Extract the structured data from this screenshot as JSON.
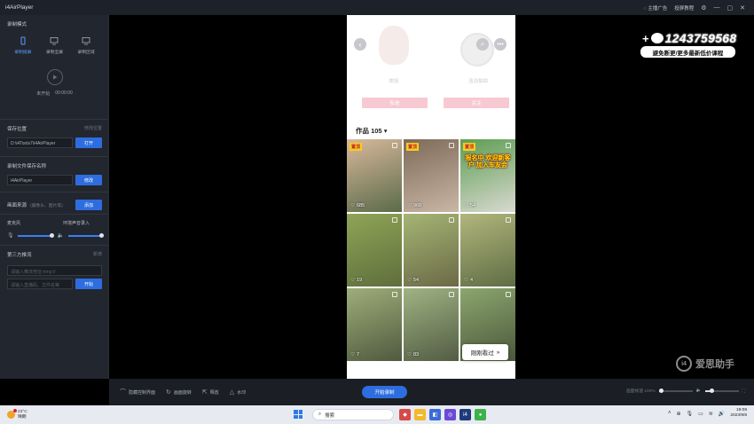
{
  "app": {
    "title": "i4AirPlayer"
  },
  "titlebar": {
    "ad_label": "主播广告",
    "tutorial_label": "投屏教程"
  },
  "left_panel": {
    "mode_title": "录制模式",
    "modes": [
      {
        "label": "录制投屏",
        "active": true,
        "icon": "phone-icon"
      },
      {
        "label": "录制全屏",
        "active": false,
        "icon": "monitor-icon"
      },
      {
        "label": "录制区域",
        "active": false,
        "icon": "monitor-icon"
      }
    ],
    "record_status": "未开始",
    "record_time": "00:00:00",
    "save_location": {
      "title": "保存位置",
      "action": "修改位置",
      "path": "D:\\i4Tools7\\i4AirPlayer",
      "button": "打开"
    },
    "file_name": {
      "title": "录制文件保存名称",
      "value": "i4AirPlayer",
      "button": "修改"
    },
    "picture_source": {
      "title": "画面来源",
      "hint": "(摄像头、图片等)",
      "button": "添加"
    },
    "audio": {
      "mic_label": "麦克风",
      "env_label": "环境声音录入",
      "mic_level": 1.0,
      "env_level": 1.0
    },
    "third_party": {
      "title": "第三方推流",
      "action": "新增",
      "url_placeholder": "请输入推流地址:rtmp://",
      "key_placeholder": "请输入直播码、文件名等",
      "button": "开始"
    }
  },
  "bottombar": {
    "items": [
      {
        "label": "隐藏控制界面",
        "icon": "hide-icon"
      },
      {
        "label": "画面旋转",
        "icon": "rotate-icon"
      },
      {
        "label": "释放",
        "icon": "release-icon"
      },
      {
        "label": "水印",
        "icon": "watermark-icon"
      }
    ],
    "start_record": "开始录制",
    "speed_label": "画面帧速 100%",
    "speed_level": 0.05,
    "volume_level": 0.2
  },
  "phone": {
    "left_name": "体验",
    "right_name": "洁洁拍拍",
    "right_avatar_text": "知道\n实践",
    "follow_left": "私信",
    "follow_right": "关注",
    "works_label": "作品 105",
    "tiles": [
      {
        "likes": "685",
        "pinned": true,
        "pin_label": "置顶",
        "caption": "",
        "colors": [
          "#d8b89a",
          "#5a6b4a"
        ]
      },
      {
        "likes": "968",
        "pinned": true,
        "pin_label": "置顶",
        "caption": "",
        "colors": [
          "#7d6a58",
          "#c9b6a4"
        ]
      },
      {
        "likes": "54",
        "pinned": true,
        "pin_label": "置顶",
        "caption": "报名中 欢迎新客户 加入车友会",
        "colors": [
          "#5d9d52",
          "#d9d9d0"
        ]
      },
      {
        "likes": "19",
        "pinned": false,
        "pin_label": "",
        "caption": "",
        "colors": [
          "#8fa457",
          "#5e6f3b"
        ]
      },
      {
        "likes": "54",
        "pinned": false,
        "pin_label": "",
        "caption": "",
        "colors": [
          "#a5b574",
          "#6b6a46"
        ]
      },
      {
        "likes": "4",
        "pinned": false,
        "pin_label": "",
        "caption": "",
        "colors": [
          "#b2b67c",
          "#5f6d44"
        ]
      },
      {
        "likes": "7",
        "pinned": false,
        "pin_label": "",
        "caption": "",
        "colors": [
          "#9eae7a",
          "#4f5a3e"
        ]
      },
      {
        "likes": "83",
        "pinned": false,
        "pin_label": "",
        "caption": "",
        "colors": [
          "#9fb383",
          "#525c43"
        ]
      },
      {
        "likes": "",
        "pinned": false,
        "pin_label": "",
        "caption": "",
        "colors": [
          "#8ca66e",
          "#4b583b"
        ]
      }
    ],
    "recent_label": "刚刚看过"
  },
  "overlay": {
    "wechat_number": "1243759568",
    "promo": "避免断更/更多最新低价课程",
    "watermark": "爱思助手",
    "watermark_logo": "i4"
  },
  "taskbar": {
    "temp": "23°C",
    "weather": "晴朗",
    "search": "搜索",
    "time": "19:08",
    "date": "2023/9/8"
  }
}
